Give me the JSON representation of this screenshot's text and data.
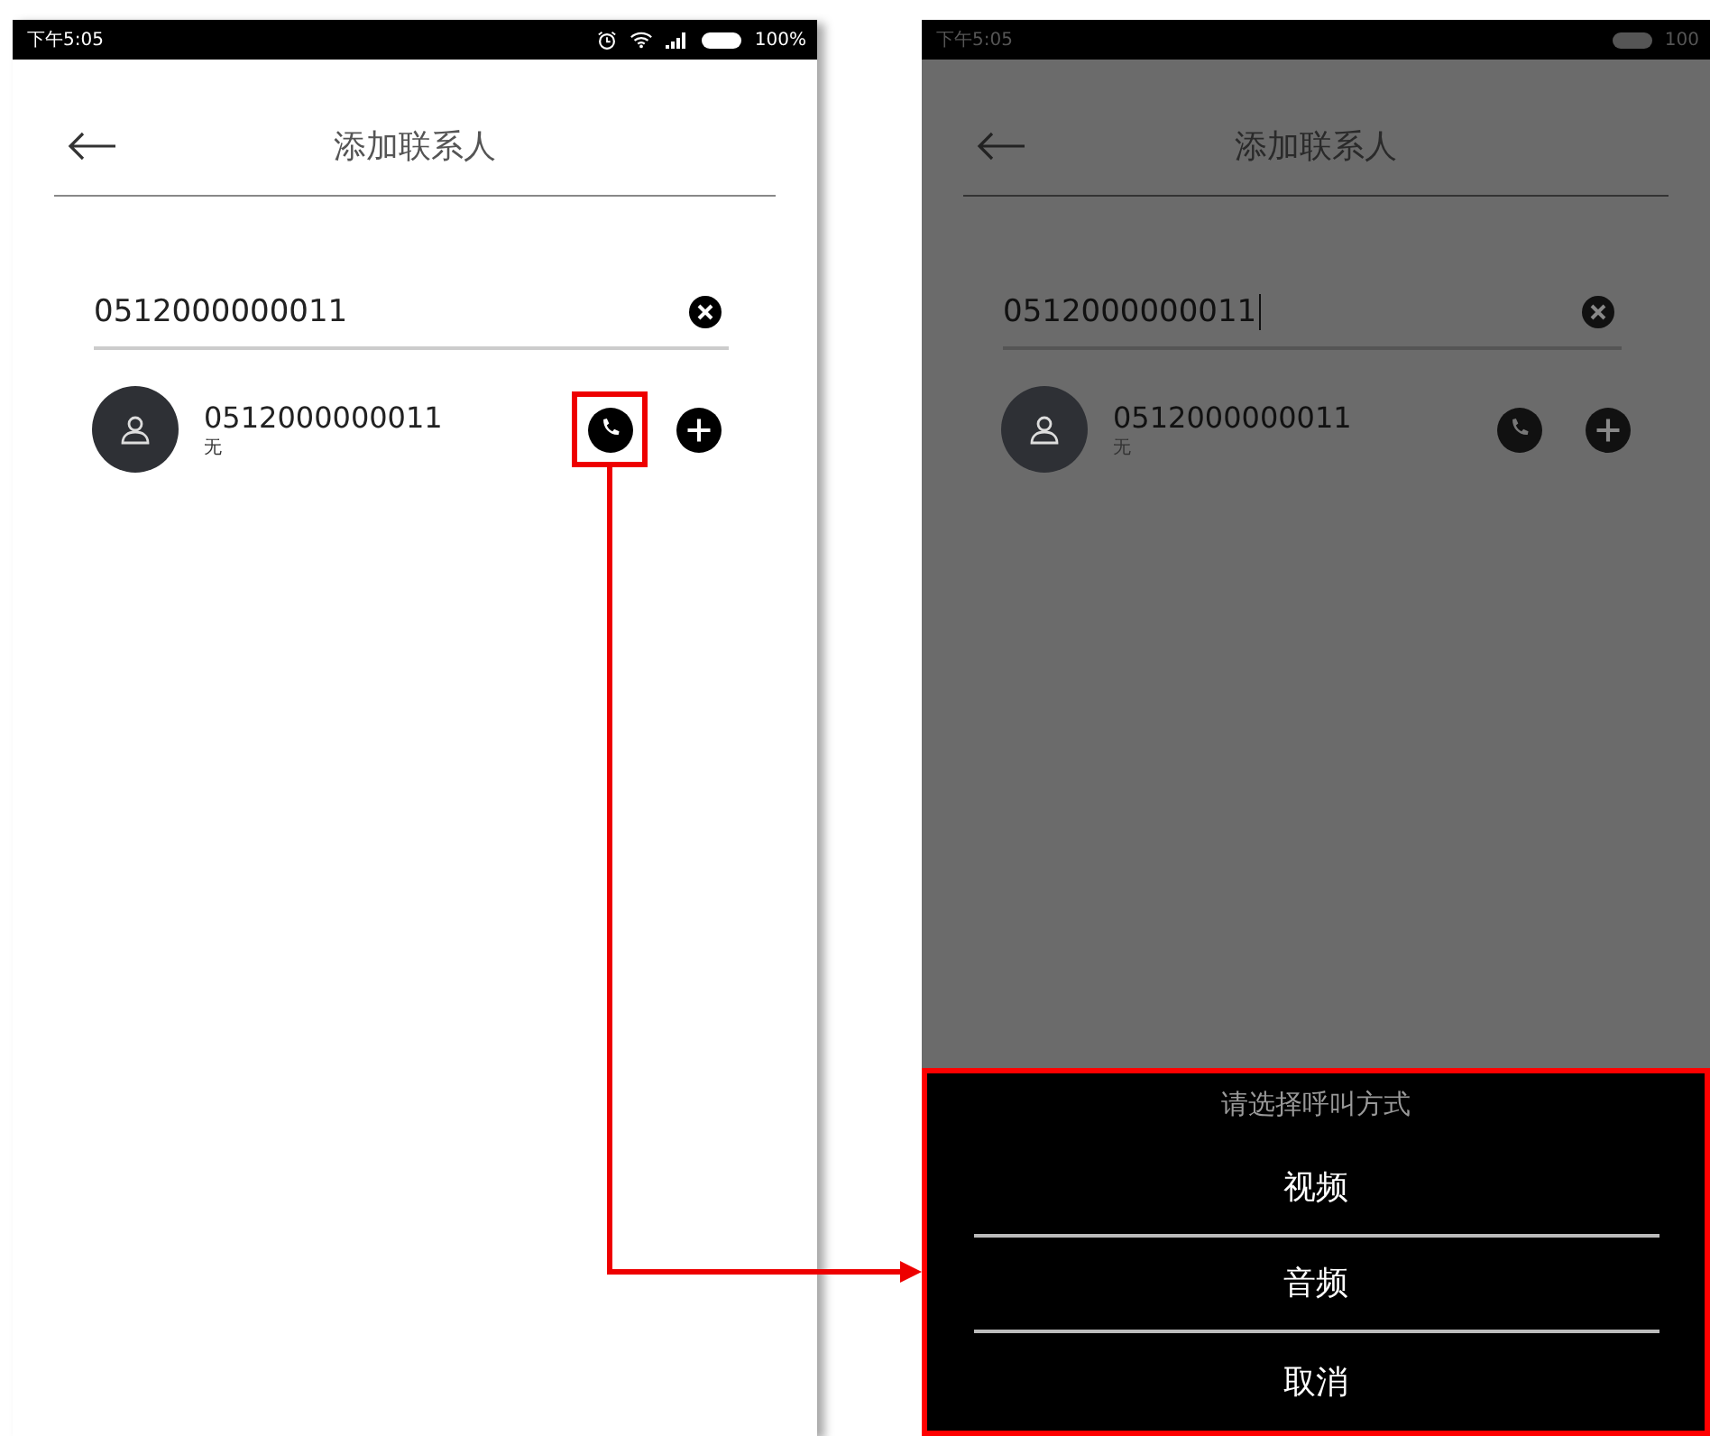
{
  "screens": [
    {
      "status_bar": {
        "time": "下午5:05",
        "battery": "100%"
      },
      "title": "添加联系人",
      "search": {
        "value": "0512000000011",
        "cursor": false
      },
      "contacts": [
        {
          "number": "0512000000011",
          "note": "无",
          "call_highlighted": true
        }
      ],
      "dimmed": false
    },
    {
      "status_bar": {
        "time": "下午5:05",
        "battery": "100"
      },
      "title": "添加联系人",
      "search": {
        "value": "0512000000011",
        "cursor": true
      },
      "contacts": [
        {
          "number": "0512000000011",
          "note": "无",
          "call_highlighted": false
        }
      ],
      "dimmed": true,
      "sheet": {
        "title": "请选择呼叫方式",
        "options": [
          "视频",
          "音频",
          "取消"
        ],
        "highlighted": true
      }
    }
  ]
}
